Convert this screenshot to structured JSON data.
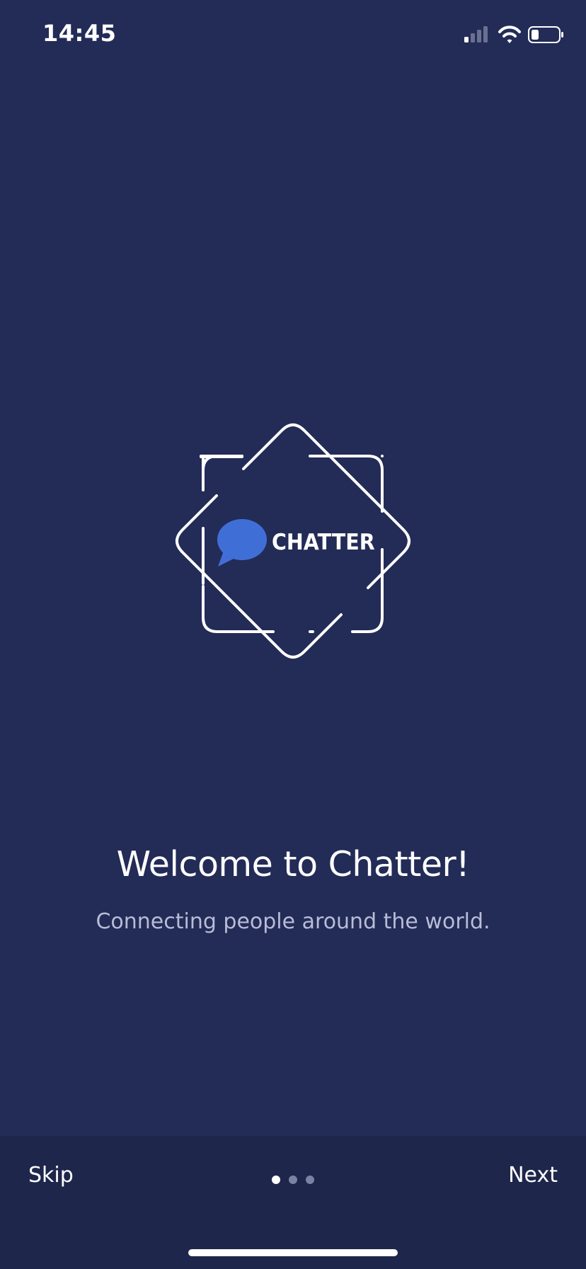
{
  "status_bar": {
    "time": "14:45",
    "icons": [
      "cellular-signal-icon",
      "wifi-icon",
      "battery-icon"
    ]
  },
  "logo": {
    "wordmark": "CHATTER",
    "icon": "speech-bubble-icon",
    "colors": {
      "frame": "#ffffff",
      "bubble": "#3f6fd6"
    }
  },
  "welcome": {
    "title": "Welcome to Chatter!",
    "subtitle": "Connecting people around the world."
  },
  "bottom_bar": {
    "skip_label": "Skip",
    "next_label": "Next",
    "page_indicator": {
      "total": 3,
      "current": 1
    }
  },
  "colors": {
    "background": "#232b57",
    "bottom_bar": "#1f264b",
    "subtitle_text": "#b8bcd6",
    "dot_inactive": "#7c82a3",
    "dot_active": "#ffffff"
  }
}
